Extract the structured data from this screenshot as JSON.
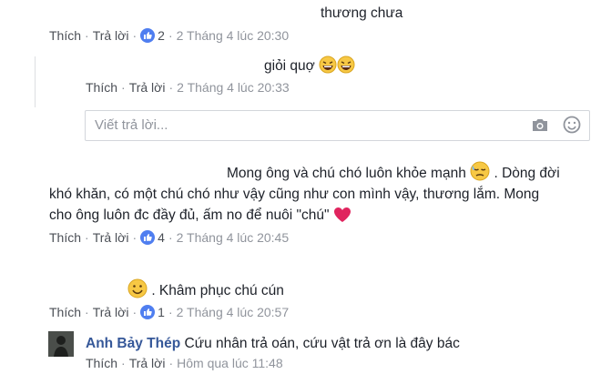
{
  "comments": [
    {
      "text": "thương chưa",
      "like_label": "Thích",
      "reply_label": "Trả lời",
      "reactions": "2",
      "time": "2 Tháng 4 lúc 20:30"
    },
    {
      "text": "giỏi quợ",
      "like_label": "Thích",
      "reply_label": "Trả lời",
      "time": "2 Tháng 4 lúc 20:33"
    },
    {
      "line1": "Mong ông và chú chó luôn khỏe mạnh",
      "line1b": ". Dòng đời",
      "line2": "khó khăn, có một chú chó như vậy cũng như con mình vậy, thương lắm. Mong",
      "line3": "cho ông luôn đc đầy đủ, ấm no để nuôi \"chú\"",
      "like_label": "Thích",
      "reply_label": "Trả lời",
      "reactions": "4",
      "time": "2 Tháng 4 lúc 20:45"
    },
    {
      "text": ". Khâm phục chú cún",
      "like_label": "Thích",
      "reply_label": "Trả lời",
      "reactions": "1",
      "time": "2 Tháng 4 lúc 20:57"
    },
    {
      "name": "Anh Bảy Thép",
      "text": "Cứu nhân trả oán, cứu vật trả ơn là đây bác",
      "like_label": "Thích",
      "reply_label": "Trả lời",
      "time": "Hôm qua lúc 11:48"
    }
  ],
  "reply_box": {
    "placeholder": "Viết trả lời..."
  },
  "colors": {
    "link": "#4b4f56",
    "meta": "#90949c",
    "name": "#365899",
    "like": "#4f7ef0",
    "heart": "#e0245e"
  }
}
